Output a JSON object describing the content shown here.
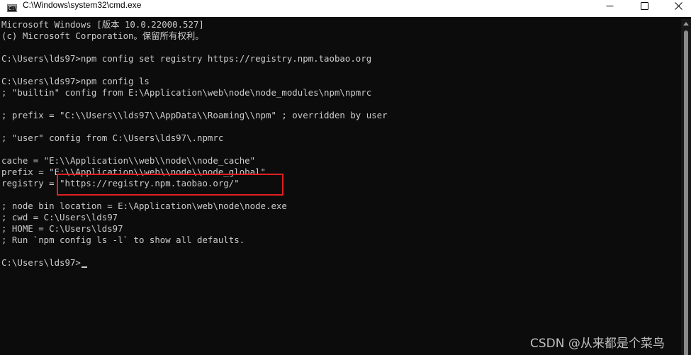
{
  "window": {
    "title": "C:\\Windows\\system32\\cmd.exe",
    "icon_text": "C:\\"
  },
  "controls": {
    "minimize": "minimize-icon",
    "maximize": "maximize-icon",
    "close": "close-icon"
  },
  "terminal": {
    "lines": [
      "Microsoft Windows [版本 10.0.22000.527]",
      "(c) Microsoft Corporation。保留所有权利。",
      "",
      "C:\\Users\\lds97>npm config set registry https://registry.npm.taobao.org",
      "",
      "C:\\Users\\lds97>npm config ls",
      "; \"builtin\" config from E:\\Application\\web\\node\\node_modules\\npm\\npmrc",
      "",
      "; prefix = \"C:\\\\Users\\\\lds97\\\\AppData\\\\Roaming\\\\npm\" ; overridden by user",
      "",
      "; \"user\" config from C:\\Users\\lds97\\.npmrc",
      "",
      "cache = \"E:\\\\Application\\\\web\\\\node\\\\node_cache\"",
      "prefix = \"E:\\\\Application\\\\web\\\\node\\\\node_global\"",
      "registry = \"https://registry.npm.taobao.org/\"",
      "",
      "; node bin location = E:\\Application\\web\\node\\node.exe",
      "; cwd = C:\\Users\\lds97",
      "; HOME = C:\\Users\\lds97",
      "; Run `npm config ls -l` to show all defaults.",
      ""
    ],
    "prompt": "C:\\Users\\lds97>"
  },
  "watermark": "CSDN @从来都是个菜鸟",
  "colors": {
    "background": "#0c0c0c",
    "text": "#cccccc",
    "highlight": "#e02020"
  }
}
